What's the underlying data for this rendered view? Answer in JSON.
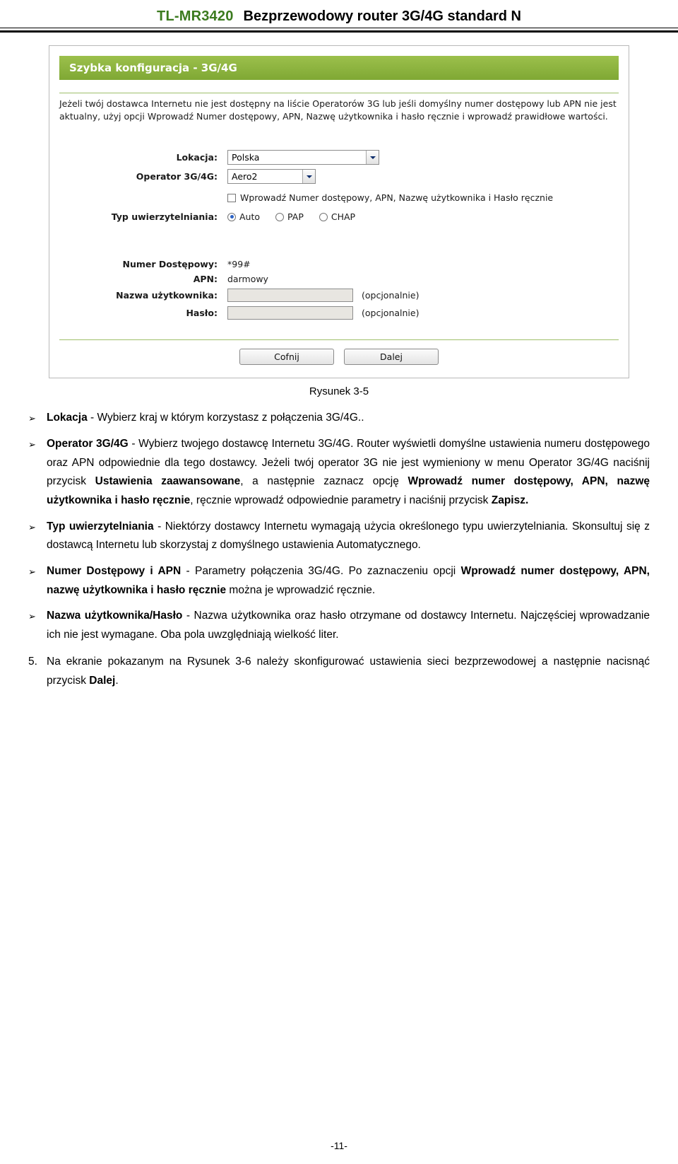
{
  "header": {
    "model": "TL-MR3420",
    "title": "Bezprzewodowy router 3G/4G standard N"
  },
  "screenshot": {
    "panel_title": "Szybka konfiguracja - 3G/4G",
    "note": "Jeżeli twój dostawca Internetu nie jest dostępny na liście Operatorów 3G lub jeśli domyślny numer dostępowy lub APN nie jest aktualny, użyj opcji Wprowadź Numer dostępowy, APN, Nazwę użytkownika i hasło ręcznie i wprowadź prawidłowe wartości.",
    "fields": {
      "lokacja_label": "Lokacja:",
      "lokacja_value": "Polska",
      "operator_label": "Operator 3G/4G:",
      "operator_value": "Aero2",
      "manual_checkbox_label": "Wprowadź Numer dostępowy, APN, Nazwę użytkownika i Hasło ręcznie",
      "auth_label": "Typ uwierzytelniania:",
      "auth_options": [
        "Auto",
        "PAP",
        "CHAP"
      ],
      "auth_selected": "Auto",
      "access_number_label": "Numer Dostępowy:",
      "access_number_value": "*99#",
      "apn_label": "APN:",
      "apn_value": "darmowy",
      "username_label": "Nazwa użytkownika:",
      "username_value": "",
      "username_hint": "(opcjonalnie)",
      "password_label": "Hasło:",
      "password_value": "",
      "password_hint": "(opcjonalnie)"
    },
    "buttons": {
      "back": "Cofnij",
      "next": "Dalej"
    },
    "accent_color": "#8db33f"
  },
  "figure_caption": "Rysunek 3-5",
  "bullets": [
    {
      "marker": "➢",
      "parts": [
        {
          "t": "Lokacja",
          "b": true
        },
        {
          "t": " - Wybierz kraj w którym korzystasz z połączenia 3G/4G..",
          "b": false
        }
      ]
    },
    {
      "marker": "➢",
      "parts": [
        {
          "t": "Operator 3G/4G",
          "b": true
        },
        {
          "t": " - Wybierz twojego dostawcę Internetu 3G/4G. Router wyświetli domyślne ustawienia numeru dostępowego oraz APN odpowiednie dla tego dostawcy. Jeżeli twój operator 3G nie jest wymieniony w menu Operator 3G/4G naciśnij przycisk ",
          "b": false
        },
        {
          "t": "Ustawienia zaawansowane",
          "b": true
        },
        {
          "t": ", a następnie zaznacz opcję ",
          "b": false
        },
        {
          "t": "Wprowadź numer dostępowy, APN, nazwę użytkownika i hasło ręcznie",
          "b": true
        },
        {
          "t": ", ręcznie wprowadź odpowiednie parametry i naciśnij przycisk ",
          "b": false
        },
        {
          "t": "Zapisz.",
          "b": true
        }
      ]
    },
    {
      "marker": "➢",
      "parts": [
        {
          "t": "Typ uwierzytelniania",
          "b": true
        },
        {
          "t": " - Niektórzy dostawcy Internetu wymagają użycia określonego typu uwierzytelniania. Skonsultuj się z dostawcą Internetu lub skorzystaj z domyślnego ustawienia Automatycznego.",
          "b": false
        }
      ]
    },
    {
      "marker": "➢",
      "parts": [
        {
          "t": "Numer Dostępowy i APN",
          "b": true
        },
        {
          "t": " - Parametry połączenia 3G/4G. Po zaznaczeniu opcji ",
          "b": false
        },
        {
          "t": "Wprowadź numer dostępowy, APN, nazwę użytkownika i hasło ręcznie",
          "b": true
        },
        {
          "t": " można je wprowadzić ręcznie.",
          "b": false
        }
      ]
    },
    {
      "marker": "➢",
      "parts": [
        {
          "t": "Nazwa użytkownika/Hasło",
          "b": true
        },
        {
          "t": " - Nazwa użytkownika oraz hasło otrzymane od dostawcy Internetu. Najczęściej wprowadzanie ich nie jest wymagane. Oba pola uwzględniają wielkość liter.",
          "b": false
        }
      ]
    }
  ],
  "numbered": [
    {
      "marker": "5.",
      "parts": [
        {
          "t": "Na ekranie pokazanym na Rysunek 3-6 należy skonfigurować ustawienia sieci bezprzewodowej a następnie nacisnąć przycisk ",
          "b": false
        },
        {
          "t": "Dalej",
          "b": true
        },
        {
          "t": ".",
          "b": false
        }
      ]
    }
  ],
  "footer": {
    "page_number": "-11-"
  }
}
